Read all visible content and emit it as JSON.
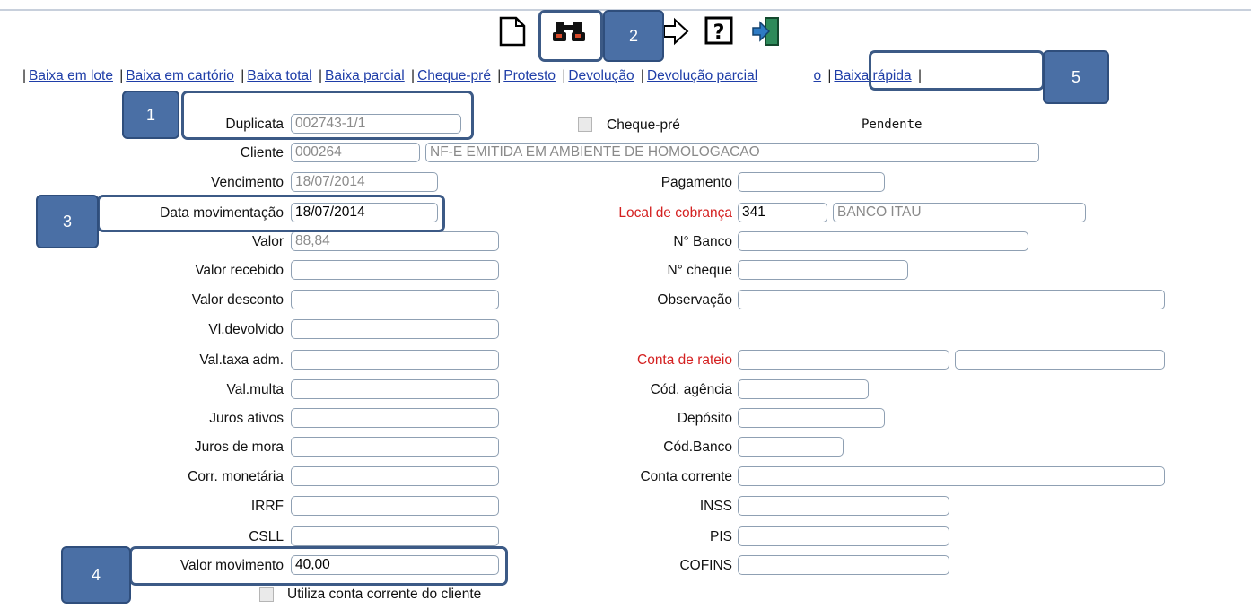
{
  "nav_links": [
    "Baixa em lote",
    "Baixa em cartório",
    "Baixa total",
    "Baixa parcial",
    "Cheque-pré",
    "Protesto",
    "Devolução",
    "Devolução parcial",
    "o",
    "Baixa rápida"
  ],
  "callouts": [
    "1",
    "2",
    "3",
    "4",
    "5"
  ],
  "toolbar": {
    "icons": [
      "new-document-icon",
      "binoculars-search-icon",
      "arrow-next-icon",
      "help-icon",
      "exit-icon"
    ]
  },
  "form": {
    "duplicata": {
      "label": "Duplicata",
      "value": "002743-1/1"
    },
    "cheque_pre": {
      "label": "Cheque-pré",
      "checked": false
    },
    "status": "Pendente",
    "cliente": {
      "label": "Cliente",
      "code": "000264",
      "name": "NF-E EMITIDA EM AMBIENTE DE HOMOLOGACAO"
    },
    "vencimento": {
      "label": "Vencimento",
      "value": "18/07/2014"
    },
    "pagamento": {
      "label": "Pagamento",
      "value": ""
    },
    "data_movimentacao": {
      "label": "Data movimentação",
      "value": "18/07/2014"
    },
    "local_cobranca": {
      "label": "Local de cobrança",
      "code": "341",
      "name": "BANCO ITAU"
    },
    "valor": {
      "label": "Valor",
      "value": "88,84"
    },
    "n_banco": {
      "label": "N° Banco",
      "value": ""
    },
    "valor_recebido": {
      "label": "Valor recebido",
      "value": ""
    },
    "n_cheque": {
      "label": "N° cheque",
      "value": ""
    },
    "valor_desconto": {
      "label": "Valor desconto",
      "value": ""
    },
    "observacao": {
      "label": "Observação",
      "value": ""
    },
    "vl_devolvido": {
      "label": "Vl.devolvido",
      "value": ""
    },
    "val_taxa_adm": {
      "label": "Val.taxa adm.",
      "value": ""
    },
    "conta_rateio": {
      "label": "Conta de rateio",
      "value1": "",
      "value2": ""
    },
    "val_multa": {
      "label": "Val.multa",
      "value": ""
    },
    "cod_agencia": {
      "label": "Cód. agência",
      "value": ""
    },
    "juros_ativos": {
      "label": "Juros ativos",
      "value": ""
    },
    "deposito": {
      "label": "Depósito",
      "value": ""
    },
    "juros_mora": {
      "label": "Juros de mora",
      "value": ""
    },
    "cod_banco": {
      "label": "Cód.Banco",
      "value": ""
    },
    "corr_monetaria": {
      "label": "Corr. monetária",
      "value": ""
    },
    "conta_corrente": {
      "label": "Conta corrente",
      "value": ""
    },
    "irrf": {
      "label": "IRRF",
      "value": ""
    },
    "inss": {
      "label": "INSS",
      "value": ""
    },
    "csll": {
      "label": "CSLL",
      "value": ""
    },
    "pis": {
      "label": "PIS",
      "value": ""
    },
    "valor_movimento": {
      "label": "Valor movimento",
      "value": "40,00"
    },
    "cofins": {
      "label": "COFINS",
      "value": ""
    },
    "utiliza_cc": {
      "label": "Utiliza conta corrente do cliente",
      "checked": false
    }
  },
  "colors": {
    "link": "#1f3ea8",
    "required_label": "#d42020",
    "callout": "#4a6fa5",
    "highlight": "#3c5a86"
  }
}
